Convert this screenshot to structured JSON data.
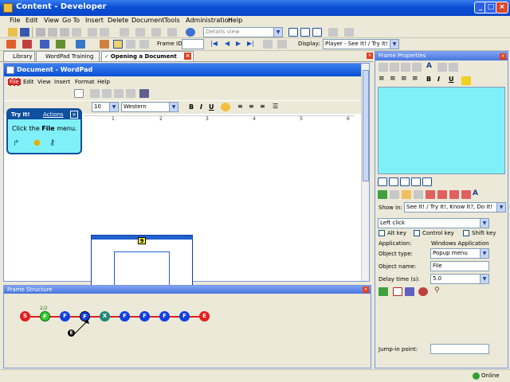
{
  "title": "Content - Developer",
  "menu": [
    "File",
    "Edit",
    "View",
    "Go To",
    "Insert",
    "Delete",
    "Document",
    "Tools",
    "Administration",
    "Help"
  ],
  "toolbar1": {
    "view_combo": "Details view"
  },
  "toolbar2": {
    "frame_id_label": "Frame ID:",
    "display_label": "Display:",
    "display_value": "Player - See It! / Try It!"
  },
  "tabs": [
    "Library",
    "WordPad Training",
    "Opening a Document"
  ],
  "doc": {
    "title": "Document - WordPad",
    "menu": [
      "File",
      "Edit",
      "View",
      "Insert",
      "Format",
      "Help"
    ],
    "font_size": "10",
    "script": "Western",
    "ruler": [
      "1",
      "2",
      "3",
      "4",
      "5",
      "6"
    ]
  },
  "tryit": {
    "title": "Try It!",
    "actions": "Actions",
    "text_pre": "Click the ",
    "text_bold": "File",
    "text_post": " menu."
  },
  "thumb_badge": "9",
  "frame_structure": {
    "title": "Frame Structure",
    "count_label": "2/2",
    "nodes": [
      {
        "t": "S",
        "c": "#E02020"
      },
      {
        "t": "F",
        "c": "#2ECC2E"
      },
      {
        "t": "F",
        "c": "#1040E0"
      },
      {
        "t": "F",
        "c": "#1040E0"
      },
      {
        "t": "X",
        "c": "#208878"
      },
      {
        "t": "F",
        "c": "#1040E0"
      },
      {
        "t": "F",
        "c": "#1040E0"
      },
      {
        "t": "F",
        "c": "#1040E0"
      },
      {
        "t": "F",
        "c": "#1040E0"
      },
      {
        "t": "E",
        "c": "#E02020"
      }
    ],
    "sub_node": "E"
  },
  "frame_properties": {
    "title": "Frame Properties",
    "show_in_label": "Show in:",
    "show_in_value": "See It! / Try It!, Know It?, Do It!",
    "event": "Left click",
    "alt_key": "Alt key",
    "control_key": "Control key",
    "shift_key": "Shift key",
    "application_label": "Application:",
    "application_value": "Windows Application",
    "object_type_label": "Object type:",
    "object_type_value": "Popup menu",
    "object_name_label": "Object name:",
    "object_name_value": "File",
    "delay_label": "Delay time (s):",
    "delay_value": "5.0",
    "jump_label": "Jump-in point:"
  },
  "status": {
    "online": "Online"
  },
  "colors": {
    "titlebar": "#0A4FD4",
    "preview": "#80F0F8",
    "workspace": "#ECE9D8"
  }
}
